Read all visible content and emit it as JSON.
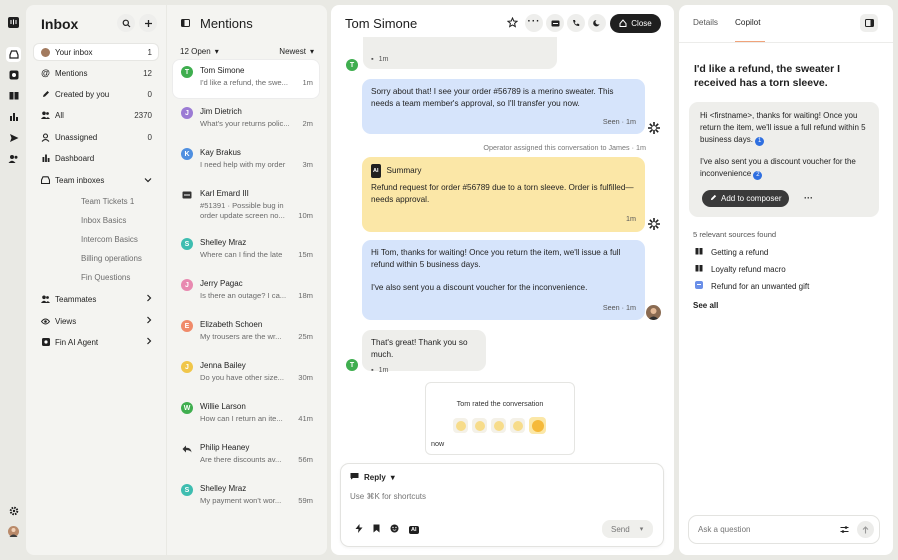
{
  "rail": {
    "icons": [
      "intercom-logo-icon",
      "inbox-icon",
      "fin-icon",
      "knowledge-icon",
      "reports-icon",
      "outbound-icon",
      "contacts-icon",
      "settings-icon",
      "user-avatar"
    ]
  },
  "inbox": {
    "title": "Inbox",
    "nav": [
      {
        "label": "Your inbox",
        "count": "1",
        "icon": "avatar"
      },
      {
        "label": "Mentions",
        "count": "12",
        "icon": "at-icon"
      },
      {
        "label": "Created by you",
        "count": "0",
        "icon": "pencil-icon"
      },
      {
        "label": "All",
        "count": "2370",
        "icon": "people-icon"
      },
      {
        "label": "Unassigned",
        "count": "0",
        "icon": "unassigned-icon"
      },
      {
        "label": "Dashboard",
        "count": "",
        "icon": "bar-chart-icon"
      }
    ],
    "team_inboxes": "Team inboxes",
    "team_items": [
      "Team Tickets 1",
      "Inbox Basics",
      "Intercom Basics",
      "Billing operations",
      "Fin Questions"
    ],
    "teammates": "Teammates",
    "views": "Views",
    "fin_agent": "Fin AI Agent"
  },
  "mentions": {
    "title": "Mentions",
    "filter": "12 Open",
    "sort": "Newest",
    "items": [
      {
        "name": "Tom Simone",
        "text": "I'd like a refund, the swe...",
        "time": "1m",
        "initial": "T",
        "color": "#3fae4f"
      },
      {
        "name": "Jim Dietrich",
        "text": "What's your returns polic...",
        "time": "2m",
        "initial": "J",
        "color": "#9b7bd4"
      },
      {
        "name": "Kay Brakus",
        "text": "I need help with my order",
        "time": "3m",
        "initial": "K",
        "color": "#4f8fe0"
      },
      {
        "name": "Karl Emard III",
        "text": "#51391 · Possible bug in",
        "text2": "order update screen no...",
        "time": "10m",
        "initial": "",
        "color": "#444"
      },
      {
        "name": "Shelley Mraz",
        "text": "Where can I find the late",
        "time": "15m",
        "initial": "S",
        "color": "#3ebdb0"
      },
      {
        "name": "Jerry Pagac",
        "text": "Is there an outage? I ca...",
        "time": "18m",
        "initial": "J",
        "color": "#e889b0"
      },
      {
        "name": "Elizabeth Schoen",
        "text": "My trousers are the wr...",
        "time": "25m",
        "initial": "E",
        "color": "#f08a6a"
      },
      {
        "name": "Jenna Bailey",
        "text": "Do you have other size...",
        "time": "30m",
        "initial": "J",
        "color": "#f0c64a"
      },
      {
        "name": "Willie Larson",
        "text": "How can I return an ite...",
        "time": "41m",
        "initial": "W",
        "color": "#3fae4f"
      },
      {
        "name": "Philip Heaney",
        "text": "Are there discounts av...",
        "time": "56m",
        "initial": "",
        "color": "#444"
      },
      {
        "name": "Shelley Mraz",
        "text": "My payment won't wor...",
        "time": "59m",
        "initial": "S",
        "color": "#3ebdb0"
      }
    ]
  },
  "conversation": {
    "title": "Tom Simone",
    "close_label": "Close",
    "top_time": "1m",
    "msg1": "Sorry about that! I see your order #56789 is a merino sweater. This needs a team member's approval, so I'll transfer you now.",
    "msg1_meta": "Seen · 1m",
    "event": "Operator assigned this conversation to James · 1m",
    "summary_label": "Summary",
    "summary_text": "Refund request for order #56789 due to a torn sleeve. Order is fulfilled—needs approval.",
    "summary_time": "1m",
    "msg2a": "Hi Tom, thanks for waiting! Once you return the item, we'll issue a full refund within 5 business days.",
    "msg2b": "I've also sent you a discount voucher for the inconvenience.",
    "msg2_meta": "Seen · 1m",
    "msg3": "That's great! Thank you so much.",
    "msg3_time": "1m",
    "rating_label": "Tom rated the conversation",
    "rating_time": "now",
    "reply_label": "Reply",
    "composer_placeholder": "Use ⌘K for shortcuts",
    "send_label": "Send"
  },
  "side": {
    "tabs": [
      "Details",
      "Copilot"
    ],
    "question": "I'd like a refund, the sweater I received has a torn sleeve.",
    "answer1": "Hi <firstname>, thanks for waiting! Once you return the item, we'll issue a full refund within 5 business days.",
    "answer2": "I've also sent you a discount voucher for the inconvenience",
    "cite1": "1",
    "cite2": "2",
    "add_label": "Add to composer",
    "sources_label": "5 relevant sources found",
    "sources": [
      "Getting a refund",
      "Loyalty refund macro",
      "Refund for an unwanted gift"
    ],
    "see_all": "See all",
    "ask_placeholder": "Ask a question"
  }
}
